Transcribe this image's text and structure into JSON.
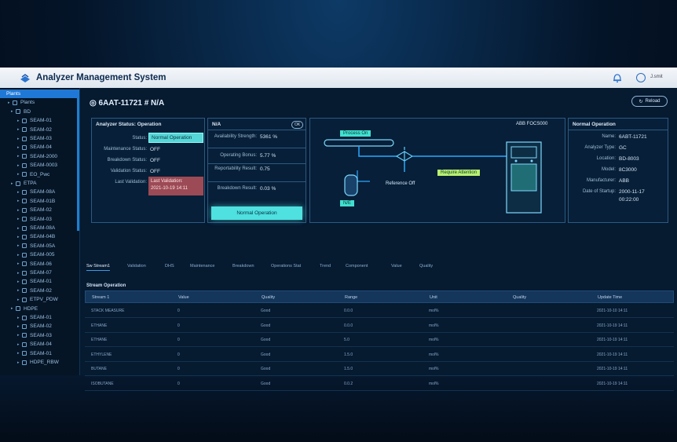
{
  "app": {
    "title": "Analyzer Management System",
    "user": "J.smit"
  },
  "sidebar": {
    "root": "Plants",
    "groups": [
      {
        "label": "Plants",
        "level": 1
      },
      {
        "label": "BD",
        "level": 2,
        "children": [
          "SEAM-01",
          "SEAM-02",
          "SEAM-03",
          "SEAM-04",
          "SEAM-2000",
          "SEAM-0003",
          "EO_Pwc"
        ]
      },
      {
        "label": "ETPA",
        "level": 2,
        "children": [
          "SEAM-08A",
          "SEAM-01B",
          "SEAM-02",
          "SEAM-03",
          "SEAM-08A",
          "SEAM-04B",
          "SEAM-05A",
          "SEAM-005",
          "SEAM-06",
          "SEAM-07",
          "SEAM-01",
          "SEAM-02",
          "ETPV_PDW"
        ]
      },
      {
        "label": "HDPE",
        "level": 2,
        "children": [
          "SEAM-01",
          "SEAM-02",
          "SEAM-03",
          "SEAM-04",
          "SEAM-01",
          "HDPE_RBW"
        ]
      }
    ]
  },
  "header": {
    "asset": "6AAT-11721 # N/A",
    "reload_label": "Reload"
  },
  "status_panel": {
    "title": "Analyzer Status: Operation",
    "rows": [
      {
        "label": "Status:",
        "value": "Normal Operation"
      },
      {
        "label": "Maintenance Status:",
        "value": "OFF"
      },
      {
        "label": "Breakdown Status:",
        "value": "OFF"
      },
      {
        "label": "Validation Status:",
        "value": "OFF"
      },
      {
        "label": "Last Validation:",
        "value": "Last Validation:",
        "value2": "2021-10-19 14:11"
      }
    ]
  },
  "kpi_panel": {
    "title": "N/A",
    "badge": "OK",
    "rows": [
      {
        "label": "Availability Strength:",
        "value": "5361 %"
      },
      {
        "label": "Operating Bonus:",
        "value": "5.77 %"
      },
      {
        "label": "Reportability Result:",
        "value": "0.75"
      },
      {
        "label": "Breakdown Result:",
        "value": "0.03 %"
      }
    ],
    "button": "Normal Operation"
  },
  "diagram": {
    "title": "ABB FOCS000",
    "process_on": "Process On",
    "require_attention": "Require Attention",
    "reference_off": "Reference Off",
    "vessel_tag": "N/E"
  },
  "info_panel": {
    "title": "Normal Operation",
    "rows": [
      {
        "label": "Name:",
        "value": "6ABT-11721"
      },
      {
        "label": "Analyzer Type:",
        "value": "GC"
      },
      {
        "label": "Location:",
        "value": "BD-8003"
      },
      {
        "label": "Model:",
        "value": "8C3000"
      },
      {
        "label": "Manufacturer:",
        "value": "ABB"
      },
      {
        "label": "Date of Startup:",
        "value": "2000-11-17",
        "value2": "00:22:00"
      }
    ]
  },
  "tabs": [
    "Sw Stream1",
    "Validation",
    "DHS",
    "Maintenance",
    "Breakdown",
    "Operations Stat",
    "Trend",
    "Component",
    "Value",
    "Quality"
  ],
  "table": {
    "caption": "Stream Operation",
    "headers": [
      "Stream 1",
      "Value",
      "Quality",
      "Range",
      "Unit",
      "Quality",
      "Update Time"
    ],
    "rows": [
      [
        "STACK MEASURE",
        "0",
        "Good",
        "0.0.0",
        "mol%",
        "2021-10-10 14:11"
      ],
      [
        "ETHANE",
        "0",
        "Good",
        "0.0.0",
        "mol%",
        "2021-10-19 14:11"
      ],
      [
        "ETHANE",
        "0",
        "Good",
        "5.0",
        "mol%",
        "2021-10-19 14:11"
      ],
      [
        "ETHYLENE",
        "0",
        "Good",
        "1.5.0",
        "mol%",
        "2021-10-19 14:11"
      ],
      [
        "BUTANE",
        "0",
        "Good",
        "1.5.0",
        "mol%",
        "2021-10-19 14:11"
      ],
      [
        "ISOBUTANE",
        "0",
        "Good",
        "0.0.2",
        "mol%",
        "2021-10-19 14:11"
      ]
    ]
  }
}
